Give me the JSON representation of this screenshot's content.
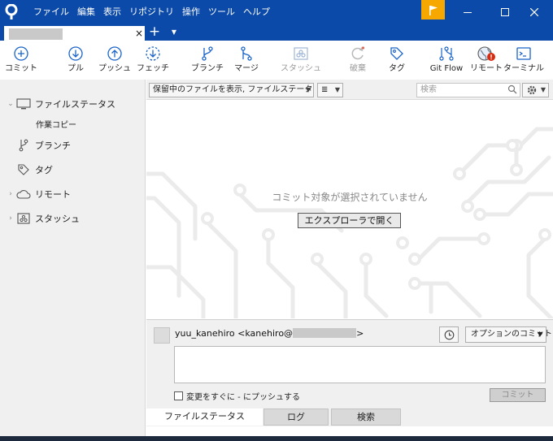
{
  "menu": [
    "ファイル",
    "編集",
    "表示",
    "リポジトリ",
    "操作",
    "ツール",
    "ヘルプ"
  ],
  "tab": {
    "close": "×",
    "add": "+",
    "dropdown": "▼"
  },
  "toolbar": {
    "commit": "コミット",
    "pull": "プル",
    "push": "プッシュ",
    "fetch": "フェッチ",
    "branch": "ブランチ",
    "merge": "マージ",
    "stash": "スタッシュ",
    "discard": "破棄",
    "tag": "タグ",
    "gitflow": "Git Flow",
    "remote": "リモート",
    "terminal": "ターミナル"
  },
  "sidebar": {
    "file_status": "ファイルステータス",
    "working_copy": "作業コピー",
    "branches": "ブランチ",
    "tags": "タグ",
    "remotes": "リモート",
    "stashes": "スタッシュ"
  },
  "filter": {
    "view_mode": "保留中のファイルを表示, ファイルステータス順",
    "list_mode": "≣",
    "search_placeholder": "検索"
  },
  "main": {
    "empty_message": "コミット対象が選択されていません",
    "open_explorer": "エクスプローラで開く"
  },
  "commit": {
    "author_prefix": "yuu_kanehiro <kanehiro@",
    "author_suffix": ">",
    "options": "オプションのコミット",
    "push_immediately": "変更をすぐに - にプッシュする",
    "commit_button": "コミット"
  },
  "bottom_tabs": [
    "ファイルステータス",
    "ログ",
    "検索"
  ],
  "colors": {
    "titlebar": "#0b4aa8",
    "accent_icon": "#1a64c8",
    "flag": "#f6a800",
    "error_badge": "#d9290f"
  }
}
